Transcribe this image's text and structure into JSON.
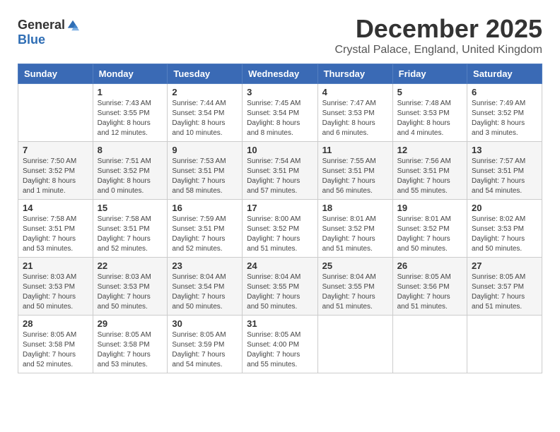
{
  "header": {
    "logo_general": "General",
    "logo_blue": "Blue",
    "month_title": "December 2025",
    "location": "Crystal Palace, England, United Kingdom"
  },
  "days_of_week": [
    "Sunday",
    "Monday",
    "Tuesday",
    "Wednesday",
    "Thursday",
    "Friday",
    "Saturday"
  ],
  "weeks": [
    [
      {
        "day": "",
        "info": ""
      },
      {
        "day": "1",
        "info": "Sunrise: 7:43 AM\nSunset: 3:55 PM\nDaylight: 8 hours\nand 12 minutes."
      },
      {
        "day": "2",
        "info": "Sunrise: 7:44 AM\nSunset: 3:54 PM\nDaylight: 8 hours\nand 10 minutes."
      },
      {
        "day": "3",
        "info": "Sunrise: 7:45 AM\nSunset: 3:54 PM\nDaylight: 8 hours\nand 8 minutes."
      },
      {
        "day": "4",
        "info": "Sunrise: 7:47 AM\nSunset: 3:53 PM\nDaylight: 8 hours\nand 6 minutes."
      },
      {
        "day": "5",
        "info": "Sunrise: 7:48 AM\nSunset: 3:53 PM\nDaylight: 8 hours\nand 4 minutes."
      },
      {
        "day": "6",
        "info": "Sunrise: 7:49 AM\nSunset: 3:52 PM\nDaylight: 8 hours\nand 3 minutes."
      }
    ],
    [
      {
        "day": "7",
        "info": "Sunrise: 7:50 AM\nSunset: 3:52 PM\nDaylight: 8 hours\nand 1 minute."
      },
      {
        "day": "8",
        "info": "Sunrise: 7:51 AM\nSunset: 3:52 PM\nDaylight: 8 hours\nand 0 minutes."
      },
      {
        "day": "9",
        "info": "Sunrise: 7:53 AM\nSunset: 3:51 PM\nDaylight: 7 hours\nand 58 minutes."
      },
      {
        "day": "10",
        "info": "Sunrise: 7:54 AM\nSunset: 3:51 PM\nDaylight: 7 hours\nand 57 minutes."
      },
      {
        "day": "11",
        "info": "Sunrise: 7:55 AM\nSunset: 3:51 PM\nDaylight: 7 hours\nand 56 minutes."
      },
      {
        "day": "12",
        "info": "Sunrise: 7:56 AM\nSunset: 3:51 PM\nDaylight: 7 hours\nand 55 minutes."
      },
      {
        "day": "13",
        "info": "Sunrise: 7:57 AM\nSunset: 3:51 PM\nDaylight: 7 hours\nand 54 minutes."
      }
    ],
    [
      {
        "day": "14",
        "info": "Sunrise: 7:58 AM\nSunset: 3:51 PM\nDaylight: 7 hours\nand 53 minutes."
      },
      {
        "day": "15",
        "info": "Sunrise: 7:58 AM\nSunset: 3:51 PM\nDaylight: 7 hours\nand 52 minutes."
      },
      {
        "day": "16",
        "info": "Sunrise: 7:59 AM\nSunset: 3:51 PM\nDaylight: 7 hours\nand 52 minutes."
      },
      {
        "day": "17",
        "info": "Sunrise: 8:00 AM\nSunset: 3:52 PM\nDaylight: 7 hours\nand 51 minutes."
      },
      {
        "day": "18",
        "info": "Sunrise: 8:01 AM\nSunset: 3:52 PM\nDaylight: 7 hours\nand 51 minutes."
      },
      {
        "day": "19",
        "info": "Sunrise: 8:01 AM\nSunset: 3:52 PM\nDaylight: 7 hours\nand 50 minutes."
      },
      {
        "day": "20",
        "info": "Sunrise: 8:02 AM\nSunset: 3:53 PM\nDaylight: 7 hours\nand 50 minutes."
      }
    ],
    [
      {
        "day": "21",
        "info": "Sunrise: 8:03 AM\nSunset: 3:53 PM\nDaylight: 7 hours\nand 50 minutes."
      },
      {
        "day": "22",
        "info": "Sunrise: 8:03 AM\nSunset: 3:53 PM\nDaylight: 7 hours\nand 50 minutes."
      },
      {
        "day": "23",
        "info": "Sunrise: 8:04 AM\nSunset: 3:54 PM\nDaylight: 7 hours\nand 50 minutes."
      },
      {
        "day": "24",
        "info": "Sunrise: 8:04 AM\nSunset: 3:55 PM\nDaylight: 7 hours\nand 50 minutes."
      },
      {
        "day": "25",
        "info": "Sunrise: 8:04 AM\nSunset: 3:55 PM\nDaylight: 7 hours\nand 51 minutes."
      },
      {
        "day": "26",
        "info": "Sunrise: 8:05 AM\nSunset: 3:56 PM\nDaylight: 7 hours\nand 51 minutes."
      },
      {
        "day": "27",
        "info": "Sunrise: 8:05 AM\nSunset: 3:57 PM\nDaylight: 7 hours\nand 51 minutes."
      }
    ],
    [
      {
        "day": "28",
        "info": "Sunrise: 8:05 AM\nSunset: 3:58 PM\nDaylight: 7 hours\nand 52 minutes."
      },
      {
        "day": "29",
        "info": "Sunrise: 8:05 AM\nSunset: 3:58 PM\nDaylight: 7 hours\nand 53 minutes."
      },
      {
        "day": "30",
        "info": "Sunrise: 8:05 AM\nSunset: 3:59 PM\nDaylight: 7 hours\nand 54 minutes."
      },
      {
        "day": "31",
        "info": "Sunrise: 8:05 AM\nSunset: 4:00 PM\nDaylight: 7 hours\nand 55 minutes."
      },
      {
        "day": "",
        "info": ""
      },
      {
        "day": "",
        "info": ""
      },
      {
        "day": "",
        "info": ""
      }
    ]
  ]
}
